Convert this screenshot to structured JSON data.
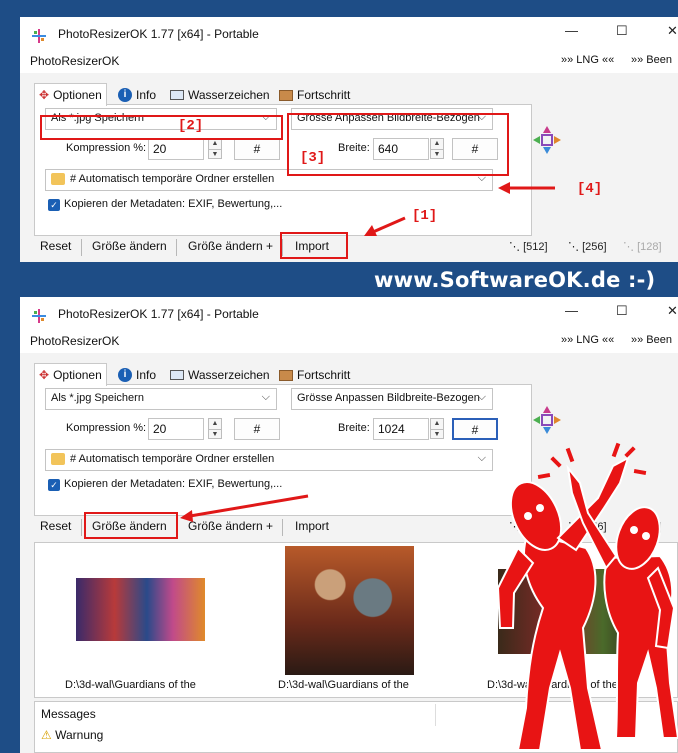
{
  "brand": "www.SoftwareOK.de :-)",
  "colors": {
    "annotation_red": "#e01818",
    "accent_blue": "#1a5fb4",
    "background": "#1e4d86"
  },
  "window": {
    "title": "PhotoResizerOK 1.77 [x64] - Portable",
    "app_name": "PhotoResizerOK",
    "lng": "»» LNG ««",
    "beend": "»» Been",
    "min_glyph": "—",
    "max_glyph": "☐",
    "close_glyph": "✕"
  },
  "tabs": [
    {
      "label": "Optionen",
      "icon": "options-icon"
    },
    {
      "label": "Info",
      "icon": "info-icon"
    },
    {
      "label": "Wasserzeichen",
      "icon": "watermark-icon"
    },
    {
      "label": "Fortschritt",
      "icon": "progress-icon"
    }
  ],
  "options": {
    "save_format": "Als *.jpg Speichern",
    "resize_mode": "Grösse Anpassen Bildbreite-Bezogen",
    "compression_label": "Kompression %:",
    "compression_value": "20",
    "width_label": "Breite:",
    "width_value_top": "640",
    "width_value_bottom": "1024",
    "hash_label": "#",
    "folder_option": "# Automatisch temporäre Ordner erstellen",
    "metadata_label": "Kopieren der Metadaten: EXIF, Bewertung,..."
  },
  "actions": {
    "reset": "Reset",
    "resize": "Größe ändern",
    "resize_plus": "Größe ändern +",
    "import": "Import",
    "zoom": [
      "[512]",
      "[256]",
      "[128]"
    ]
  },
  "annotations": {
    "n1": "[1]",
    "n2": "[2]",
    "n3": "[3]",
    "n4": "[4]"
  },
  "gallery": {
    "caption": "D:\\3d-wal\\Guardians of the"
  },
  "messages": {
    "header": "Messages",
    "warning": "Warnung"
  }
}
